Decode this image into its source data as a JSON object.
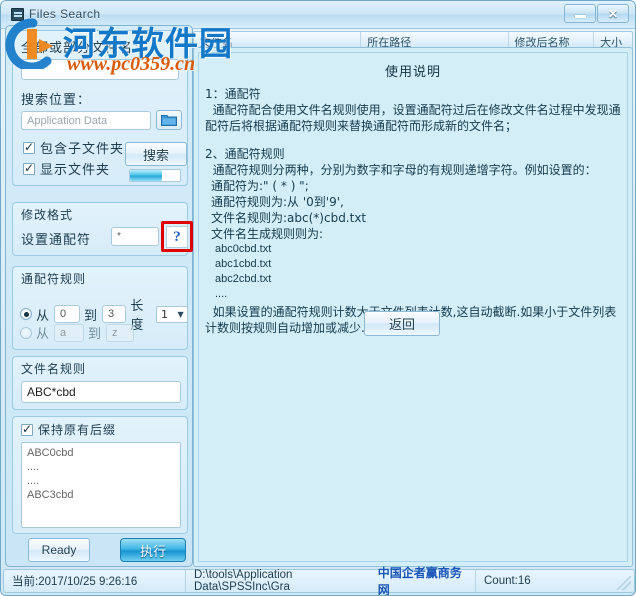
{
  "window": {
    "title": "Files Search",
    "icon": "app-icon",
    "minimize_label": "–",
    "close_label": "✕"
  },
  "results_grid": {
    "columns": [
      "文件名",
      "所在路径",
      "修改后名称",
      "大小"
    ]
  },
  "search_panel": {
    "filename_label": "全部或部分文件名：",
    "filename_value": "",
    "location_label": "搜索位置：",
    "location_value": "Application Data",
    "browse_icon": "folder-icon",
    "include_subfolders_label": "包含子文件夹",
    "include_subfolders_checked": true,
    "show_folders_label": "显示文件夹",
    "show_folders_checked": true,
    "search_button_label": "搜索",
    "progress_percent": 60
  },
  "format_panel": {
    "group_label": "修改格式",
    "wildcard_label": "设置通配符",
    "wildcard_value": "*",
    "help_button_label": "?",
    "help_highlighted": true,
    "highlight_color": "#e00000"
  },
  "wildcard_rule_panel": {
    "group_label": "通配符规则",
    "rule_numeric": {
      "selected": true,
      "from_label": "从",
      "from_value": "0",
      "to_label": "到",
      "to_value": "3",
      "length_label": "长度",
      "length_value": "1",
      "dropdown_icon": "chevron-down-icon"
    },
    "rule_alpha": {
      "selected": false,
      "from_label": "从",
      "from_value": "a",
      "to_label": "到",
      "to_value": "z"
    }
  },
  "filename_rule_panel": {
    "group_label": "文件名规则",
    "value": "ABC*cbd"
  },
  "preview_panel": {
    "keep_suffix_label": "保持原有后缀",
    "keep_suffix_checked": true,
    "items": [
      "ABC0cbd",
      "....",
      "....",
      "ABC3cbd"
    ]
  },
  "action_bar": {
    "ready_label": "Ready",
    "execute_label": "执行"
  },
  "help_panel": {
    "title": "使用说明",
    "section1_heading": "1：通配符",
    "section1_body": "  通配符配合使用文件名规则使用，设置通配符过后在修改文件名过程中发现通配符后将根据通配符规则来替换通配符而形成新的文件名；",
    "section2_heading": "2、通配符规则",
    "section2_body": "  通配符规则分两种，分别为数字和字母的有规则递增字符。例如设置的：",
    "line_wildcard": "通配符为:\" ( * ) \";",
    "line_rule": "通配符规则为:从 '0到'9',",
    "line_name_rule": "文件名规则为:abc(*)cbd.txt",
    "line_gen_rule": "文件名生成规则则为:",
    "examples": [
      "abc0cbd.txt",
      "abc1cbd.txt",
      "abc2cbd.txt",
      "...."
    ],
    "footer": "  如果设置的通配符规则计数大于文件列表计数,这自动截断.如果小于文件列表计数则按规则自动增加或减少.",
    "back_button_label": "返回"
  },
  "status_bar": {
    "current_time": "当前:2017/10/25 9:26:16",
    "path": "D:\\tools\\Application Data\\SPSSInc\\Gra",
    "count": "Count:16",
    "resize_grip": "resize-grip-icon"
  },
  "watermark": {
    "site_name": "河东软件园",
    "url": "www.pc0359.cn",
    "status_overlay": "中国企者赢商务网",
    "logo": "watermark-logo-icon"
  }
}
